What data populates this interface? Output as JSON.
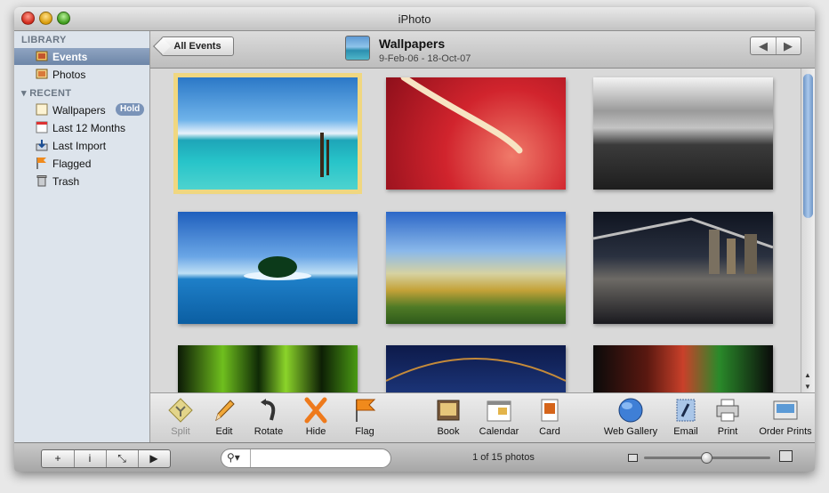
{
  "window": {
    "title": "iPhoto"
  },
  "sidebar": {
    "library_header": "LIBRARY",
    "library_items": [
      {
        "label": "Events",
        "icon": "events-icon",
        "selected": true
      },
      {
        "label": "Photos",
        "icon": "photos-icon",
        "selected": false
      }
    ],
    "recent_header": "RECENT",
    "recent_items": [
      {
        "label": "Wallpapers",
        "icon": "event-album-icon",
        "badge": "Hold"
      },
      {
        "label": "Last 12 Months",
        "icon": "calendar-icon"
      },
      {
        "label": "Last Import",
        "icon": "import-icon"
      },
      {
        "label": "Flagged",
        "icon": "flag-icon"
      },
      {
        "label": "Trash",
        "icon": "trash-icon"
      }
    ]
  },
  "header": {
    "back_button": "All Events",
    "event_title": "Wallpapers",
    "event_dates": "9-Feb-06 - 18-Oct-07",
    "nav_back": "◀",
    "nav_forward": "▶"
  },
  "photos": [
    {
      "name": "tropical-sea-posts",
      "selected": true
    },
    {
      "name": "red-leaf-macro",
      "selected": false
    },
    {
      "name": "bw-field-clouds",
      "selected": false
    },
    {
      "name": "island-palms",
      "selected": false
    },
    {
      "name": "yellow-hills",
      "selected": false
    },
    {
      "name": "night-bridge-city",
      "selected": false
    },
    {
      "name": "green-cactus-macro",
      "selected": false
    },
    {
      "name": "night-bridge-lights",
      "selected": false
    },
    {
      "name": "green-red-bokeh",
      "selected": false
    }
  ],
  "tools": {
    "split": "Split",
    "edit": "Edit",
    "rotate": "Rotate",
    "hide": "Hide",
    "flag": "Flag",
    "book": "Book",
    "calendar": "Calendar",
    "card": "Card",
    "web_gallery": "Web Gallery",
    "email": "Email",
    "print": "Print",
    "order_prints": "Order Prints"
  },
  "status": {
    "count": "1 of 15 photos",
    "search_placeholder": "",
    "buttons": [
      "+",
      "i",
      "⤡",
      "▶"
    ],
    "zoom_level": 0.45
  }
}
